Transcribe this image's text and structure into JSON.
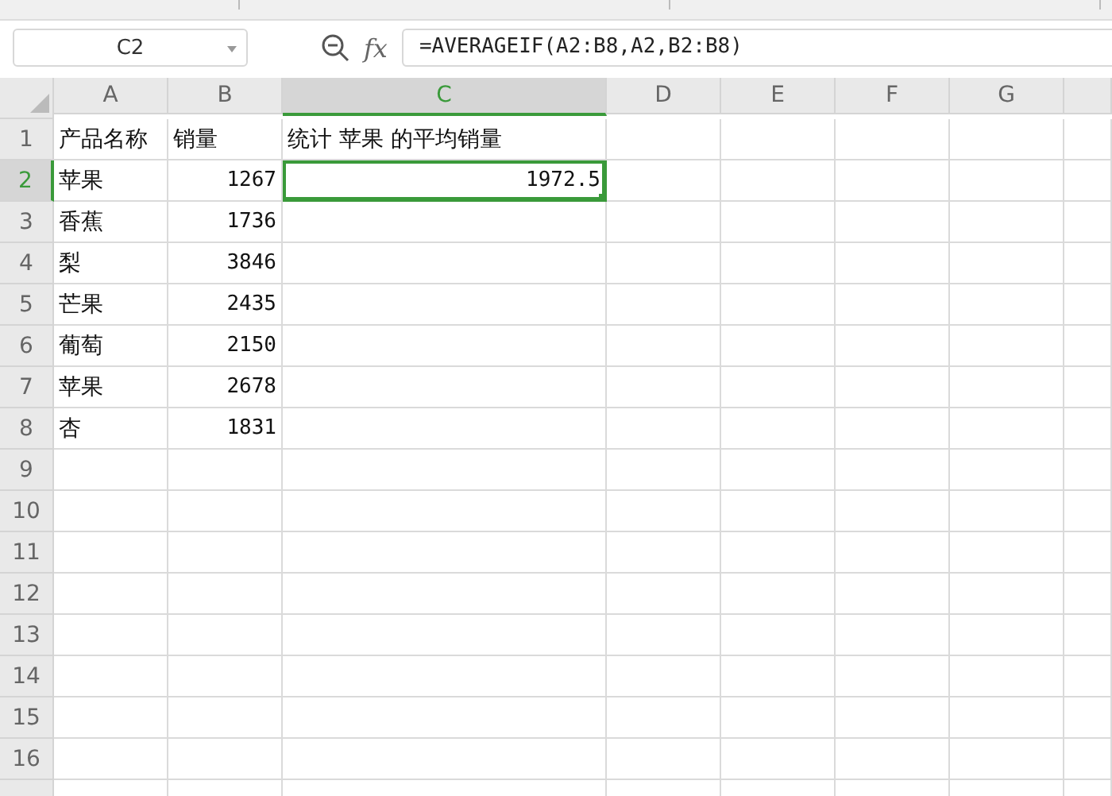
{
  "name_box": {
    "value": "C2"
  },
  "formula_bar": {
    "fx_label": "fx",
    "formula": "=AVERAGEIF(A2:B8,A2,B2:B8)"
  },
  "columns": [
    {
      "label": "A",
      "selected": false
    },
    {
      "label": "B",
      "selected": false
    },
    {
      "label": "C",
      "selected": true
    },
    {
      "label": "D",
      "selected": false
    },
    {
      "label": "E",
      "selected": false
    },
    {
      "label": "F",
      "selected": false
    },
    {
      "label": "G",
      "selected": false
    }
  ],
  "rows": [
    {
      "label": "1",
      "selected": false,
      "cells": [
        {
          "text": "产品名称",
          "kind": "text",
          "selected": false
        },
        {
          "text": "销量",
          "kind": "text",
          "selected": false
        },
        {
          "text": "统计 苹果 的平均销量",
          "kind": "text",
          "selected": false
        }
      ]
    },
    {
      "label": "2",
      "selected": true,
      "cells": [
        {
          "text": "苹果",
          "kind": "text",
          "selected": false
        },
        {
          "text": "1267",
          "kind": "number",
          "selected": false
        },
        {
          "text": "1972.5",
          "kind": "number",
          "selected": true
        }
      ]
    },
    {
      "label": "3",
      "selected": false,
      "cells": [
        {
          "text": "香蕉",
          "kind": "text",
          "selected": false
        },
        {
          "text": "1736",
          "kind": "number",
          "selected": false
        }
      ]
    },
    {
      "label": "4",
      "selected": false,
      "cells": [
        {
          "text": "梨",
          "kind": "text",
          "selected": false
        },
        {
          "text": "3846",
          "kind": "number",
          "selected": false
        }
      ]
    },
    {
      "label": "5",
      "selected": false,
      "cells": [
        {
          "text": "芒果",
          "kind": "text",
          "selected": false
        },
        {
          "text": "2435",
          "kind": "number",
          "selected": false
        }
      ]
    },
    {
      "label": "6",
      "selected": false,
      "cells": [
        {
          "text": "葡萄",
          "kind": "text",
          "selected": false
        },
        {
          "text": "2150",
          "kind": "number",
          "selected": false
        }
      ]
    },
    {
      "label": "7",
      "selected": false,
      "cells": [
        {
          "text": "苹果",
          "kind": "text",
          "selected": false
        },
        {
          "text": "2678",
          "kind": "number",
          "selected": false
        }
      ]
    },
    {
      "label": "8",
      "selected": false,
      "cells": [
        {
          "text": "杏",
          "kind": "text",
          "selected": false
        },
        {
          "text": "1831",
          "kind": "number",
          "selected": false
        }
      ]
    },
    {
      "label": "9",
      "selected": false
    },
    {
      "label": "10",
      "selected": false
    },
    {
      "label": "11",
      "selected": false
    },
    {
      "label": "12",
      "selected": false
    },
    {
      "label": "13",
      "selected": false
    },
    {
      "label": "14",
      "selected": false
    },
    {
      "label": "15",
      "selected": false
    },
    {
      "label": "16",
      "selected": false
    }
  ]
}
